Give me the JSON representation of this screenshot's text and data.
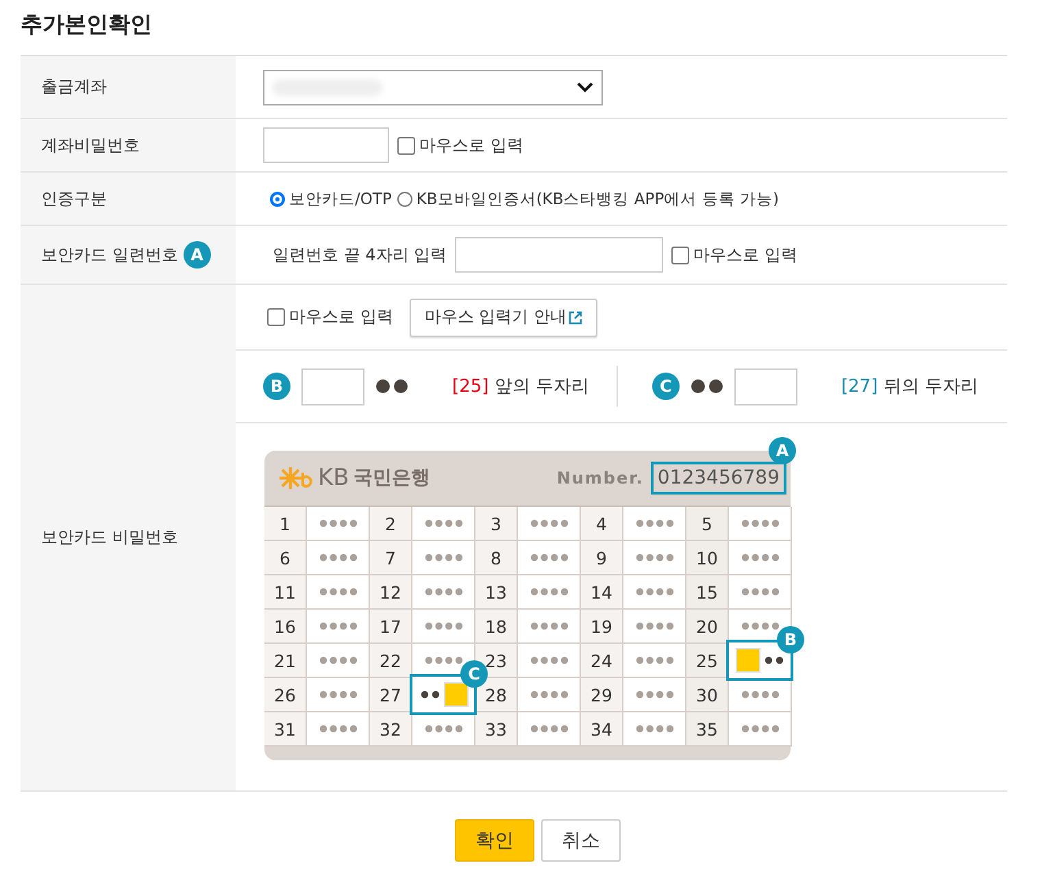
{
  "title": "추가본인확인",
  "rows": [
    {
      "kind": "select",
      "label": "출금계좌"
    },
    {
      "kind": "password",
      "label": "계좌비밀번호",
      "mouse_input": {
        "label": "마우스로 입력",
        "checked": false
      }
    },
    {
      "kind": "radio",
      "label": "인증구분",
      "options": [
        {
          "label": "보안카드/OTP",
          "selected": true
        },
        {
          "label": "KB모바일인증서(KB스타뱅킹 APP에서 등록 가능)",
          "selected": false
        }
      ]
    },
    {
      "kind": "serial",
      "label": "보안카드 일련번호",
      "badge": "A",
      "prompt": "일련번호 끝 4자리 입력",
      "mouse_input": {
        "label": "마우스로 입력",
        "checked": false
      }
    },
    {
      "kind": "card",
      "label": "보안카드 비밀번호",
      "mouse_input": {
        "label": "마우스로 입력",
        "checked": false
      },
      "guide_button": "마우스 입력기 안내",
      "digits": [
        {
          "kind": "front",
          "badge": "B",
          "index": "[25]",
          "text": "앞의 두자리"
        },
        {
          "kind": "back",
          "badge": "C",
          "index": "[27]",
          "text": "뒤의 두자리"
        }
      ],
      "card": {
        "logo_mark": "KB",
        "bank": "국민은행",
        "number_label": "Number.",
        "number": "0123456789",
        "badge": "A",
        "cells": [
          {
            "number": "1",
            "kind": "plain"
          },
          {
            "number": "2",
            "kind": "plain"
          },
          {
            "number": "3",
            "kind": "plain"
          },
          {
            "number": "4",
            "kind": "plain"
          },
          {
            "number": "5",
            "kind": "plain"
          },
          {
            "number": "6",
            "kind": "plain"
          },
          {
            "number": "7",
            "kind": "plain"
          },
          {
            "number": "8",
            "kind": "plain"
          },
          {
            "number": "9",
            "kind": "plain"
          },
          {
            "number": "10",
            "kind": "plain"
          },
          {
            "number": "11",
            "kind": "plain"
          },
          {
            "number": "12",
            "kind": "plain"
          },
          {
            "number": "13",
            "kind": "plain"
          },
          {
            "number": "14",
            "kind": "plain"
          },
          {
            "number": "15",
            "kind": "plain"
          },
          {
            "number": "16",
            "kind": "plain"
          },
          {
            "number": "17",
            "kind": "plain"
          },
          {
            "number": "18",
            "kind": "plain"
          },
          {
            "number": "19",
            "kind": "plain"
          },
          {
            "number": "20",
            "kind": "plain"
          },
          {
            "number": "21",
            "kind": "plain"
          },
          {
            "number": "22",
            "kind": "plain"
          },
          {
            "number": "23",
            "kind": "plain"
          },
          {
            "number": "24",
            "kind": "plain"
          },
          {
            "number": "25",
            "kind": "front",
            "badge": "B"
          },
          {
            "number": "26",
            "kind": "plain"
          },
          {
            "number": "27",
            "kind": "back",
            "badge": "C"
          },
          {
            "number": "28",
            "kind": "plain"
          },
          {
            "number": "29",
            "kind": "plain"
          },
          {
            "number": "30",
            "kind": "plain"
          },
          {
            "number": "31",
            "kind": "plain"
          },
          {
            "number": "32",
            "kind": "plain"
          },
          {
            "number": "33",
            "kind": "plain"
          },
          {
            "number": "34",
            "kind": "plain"
          },
          {
            "number": "35",
            "kind": "plain"
          }
        ]
      }
    }
  ],
  "buttons": [
    {
      "label": "확인",
      "kind": "primary"
    },
    {
      "label": "취소",
      "kind": "secondary"
    }
  ]
}
